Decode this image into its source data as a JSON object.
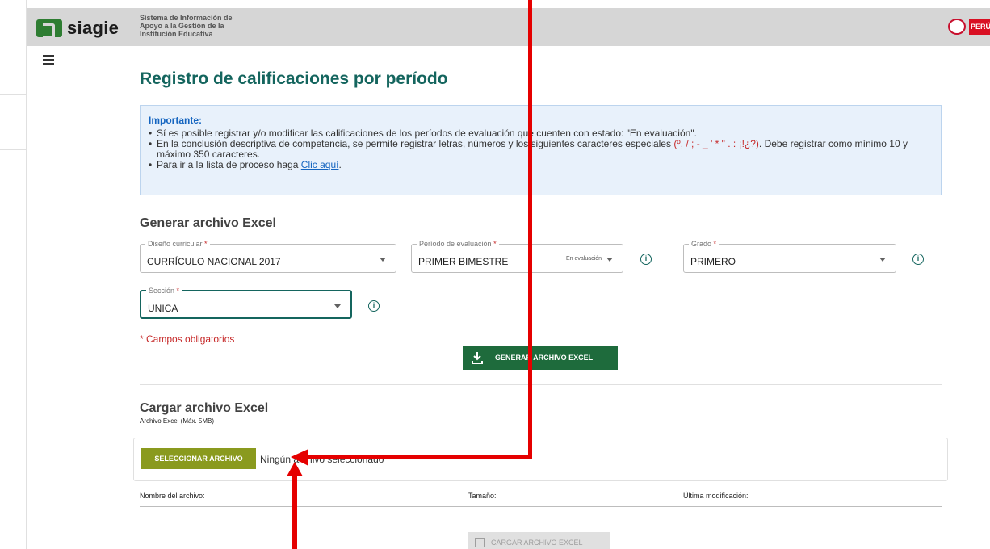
{
  "header": {
    "logo_text": "siagie",
    "subtitle": "Sistema de Información de Apoyo a la Gestión de la Institución Educativa",
    "country_label": "PERÚ"
  },
  "page": {
    "title": "Registro de calificaciones por período"
  },
  "notice": {
    "title": "Importante:",
    "item1": "Sí es posible registrar y/o modificar las calificaciones de los períodos de evaluación que cuenten con estado: \"En evaluación\".",
    "item2_pre": "En la conclusión descriptiva de competencia, se permite registrar letras, números y los siguientes caracteres especiales ",
    "item2_chars": "(º, / ; - _ ' * \" . : ¡!¿?)",
    "item2_post": ". Debe registrar como mínimo 10 y máximo 350 caracteres.",
    "item3_pre": "Para ir a la lista de proceso haga ",
    "item3_link": "Clic aquí",
    "item3_post": "."
  },
  "generate": {
    "heading": "Generar archivo Excel",
    "diseno": {
      "label": "Diseño curricular",
      "value": "CURRÍCULO NACIONAL 2017"
    },
    "periodo": {
      "label": "Período de evaluación",
      "value": "PRIMER BIMESTRE",
      "status": "En evaluación"
    },
    "grado": {
      "label": "Grado",
      "value": "PRIMERO"
    },
    "seccion": {
      "label": "Sección",
      "value": "UNICA"
    },
    "required_asterisk": "*",
    "info_glyph": "i",
    "required_note": "* Campos obligatorios",
    "button_label": "GENERAR ARCHIVO EXCEL"
  },
  "upload": {
    "heading": "Cargar archivo Excel",
    "note": "Archivo Excel (Máx. 5MB)",
    "select_button": "SELECCIONAR ARCHIVO",
    "no_file": "Ningún archivo seleccionado",
    "col_name": "Nombre del archivo:",
    "col_size": "Tamaño:",
    "col_modified": "Última modificación:",
    "load_button": "CARGAR ARCHIVO EXCEL"
  },
  "colors": {
    "title": "#14655e",
    "excel_button": "#1e6b3c",
    "select_button": "#8a9a1e",
    "annotation_arrow": "#e50000"
  }
}
